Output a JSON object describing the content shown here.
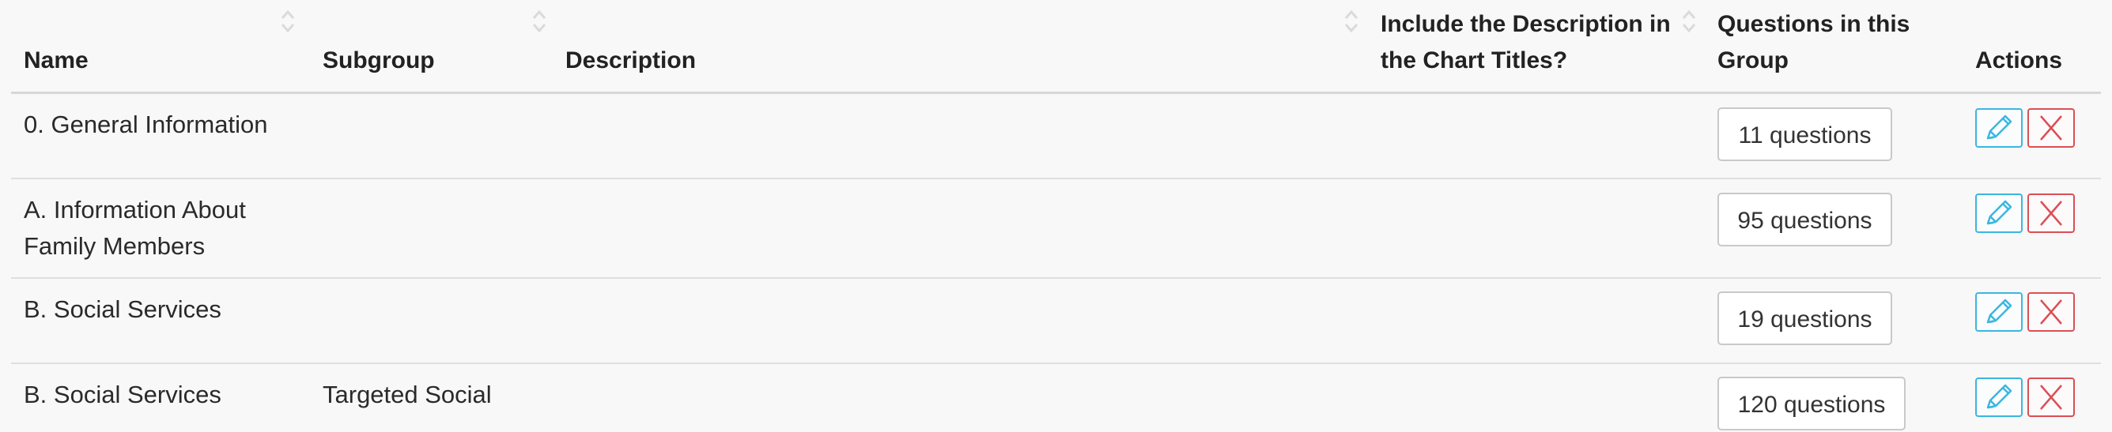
{
  "table": {
    "headers": {
      "name": "Name",
      "subgroup": "Subgroup",
      "description": "Description",
      "include_desc_line1": "Include the Description in",
      "include_desc_line2": "the Chart Titles?",
      "questions_line1": "Questions in this",
      "questions_line2": "Group",
      "actions": "Actions"
    },
    "rows": [
      {
        "name_line1": "0. General Information",
        "name_line2": "",
        "subgroup": "",
        "questions": "11 questions"
      },
      {
        "name_line1": "A. Information About",
        "name_line2": "Family Members",
        "subgroup": "",
        "questions": "95 questions"
      },
      {
        "name_line1": "B. Social Services",
        "name_line2": "",
        "subgroup": "",
        "questions": "19 questions"
      },
      {
        "name_line1": "B. Social Services",
        "name_line2": "",
        "subgroup": "Targeted Social",
        "questions": "120 questions"
      }
    ]
  },
  "icons": {
    "sort": "sort-icon",
    "edit": "pencil-icon",
    "delete": "close-icon"
  },
  "colors": {
    "edit": "#3bb6e0",
    "delete": "#db4f55",
    "sort_icon": "#d9dbda"
  }
}
